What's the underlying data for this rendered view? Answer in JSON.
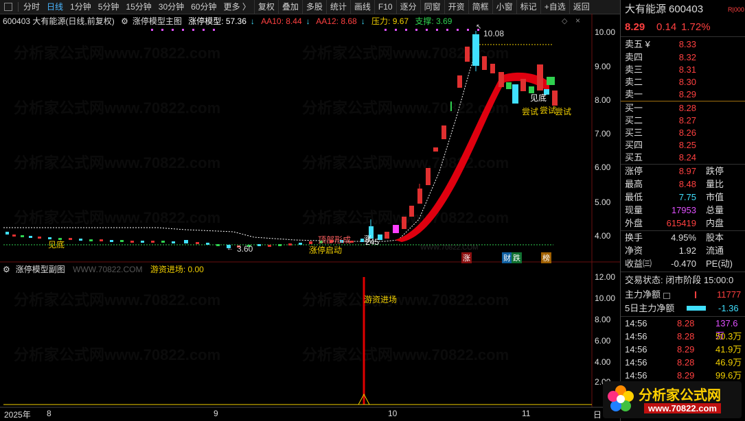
{
  "toolbar": {
    "items": [
      "分时",
      "日线",
      "1分钟",
      "5分钟",
      "15分钟",
      "30分钟",
      "60分钟",
      "更多 〉",
      "复权",
      "叠加",
      "多股",
      "统计",
      "画线",
      "F10",
      "逐分",
      "同窗",
      "开资",
      "简框",
      "小窗",
      "标记",
      "+自选",
      "返回"
    ],
    "selected": "日线"
  },
  "main_header": {
    "code_name": "600403  大有能源(日线,前复权)",
    "indicator_name": "涨停模型主图",
    "model_label": "涨停模型: 57.36",
    "aa10": "AA10: 8.44",
    "aa12": "AA12: 8.68",
    "pressure": "压力: 9.67",
    "support": "支撑: 3.69"
  },
  "sub_header": {
    "name": "涨停模型副图",
    "watermark_text": "WWW.70822.COM",
    "youzi": "游资进场: 0.00"
  },
  "watermark": "分析家公式网www.70822.com",
  "main_axis": {
    "ticks": [
      "10.00",
      "9.00",
      "8.00",
      "7.00",
      "6.00",
      "5.00",
      "4.00"
    ]
  },
  "sub_axis": {
    "ticks": [
      "12.00",
      "10.00",
      "8.00",
      "6.00",
      "4.00",
      "2.00"
    ]
  },
  "dates": {
    "year": "2025年",
    "labels": [
      "8",
      "9",
      "10",
      "11"
    ],
    "last": "日"
  },
  "chart_annotations": {
    "high": "10.08",
    "low": "3.60",
    "jiandi1": "见底",
    "jiandi2": "见底",
    "dingbu": "顶部形成",
    "zhangting_qidong": "涨停启动",
    "val245": "245",
    "zhang_mark": "涨",
    "changshi": [
      "尝试",
      "尝试",
      "尝试"
    ],
    "zhang_box": "涨",
    "cai_box": "财",
    "die_box": "跌",
    "bang_box": "榜",
    "youzi_jinchang": "游资进场",
    "site_small": "WWW.70822.COM"
  },
  "quote": {
    "name": "大有能源",
    "code": "600403",
    "badge": "R|000",
    "price": "8.29",
    "change": "0.14",
    "pct": "1.72%",
    "asks": [
      {
        "label": "卖五 ¥",
        "price": "8.33"
      },
      {
        "label": "卖四",
        "price": "8.32"
      },
      {
        "label": "卖三",
        "price": "8.31"
      },
      {
        "label": "卖二",
        "price": "8.30"
      },
      {
        "label": "卖一",
        "price": "8.29"
      }
    ],
    "bids": [
      {
        "label": "买一",
        "price": "8.28"
      },
      {
        "label": "买二",
        "price": "8.27"
      },
      {
        "label": "买三",
        "price": "8.26"
      },
      {
        "label": "买四",
        "price": "8.25"
      },
      {
        "label": "买五",
        "price": "8.24"
      }
    ],
    "stats": [
      {
        "label": "涨停",
        "value": "8.97",
        "right": "跌停"
      },
      {
        "label": "最高",
        "value": "8.48",
        "right": "量比"
      },
      {
        "label": "最低",
        "value": "7.75",
        "right": "市值"
      },
      {
        "label": "现量",
        "value": "17953",
        "right": "总量"
      },
      {
        "label": "外盘",
        "value": "615419",
        "right": "内盘"
      }
    ],
    "stats2": [
      {
        "label": "换手",
        "value": "4.95%",
        "right": "股本"
      },
      {
        "label": "净资",
        "value": "1.92",
        "right": "流通"
      },
      {
        "label": "收益㈢",
        "value": "-0.470",
        "right": "PE(动)"
      }
    ],
    "status": "交易状态: 闭市阶段 15:00:0",
    "main_net": "主力净额",
    "main_net_value": "11777",
    "five_day_net": "5日主力净额",
    "five_day_net_value": "-1.36",
    "ticks": [
      {
        "time": "14:56",
        "price": "8.28",
        "vol": "137.6万"
      },
      {
        "time": "14:56",
        "price": "8.28",
        "vol": "50.3万"
      },
      {
        "time": "14:56",
        "price": "8.29",
        "vol": "41.9万"
      },
      {
        "time": "14:56",
        "price": "8.28",
        "vol": "46.9万"
      },
      {
        "time": "14:56",
        "price": "8.29",
        "vol": "99.6万"
      }
    ]
  },
  "logo": {
    "text": "分析家公式网",
    "url": "www.70822.com"
  }
}
